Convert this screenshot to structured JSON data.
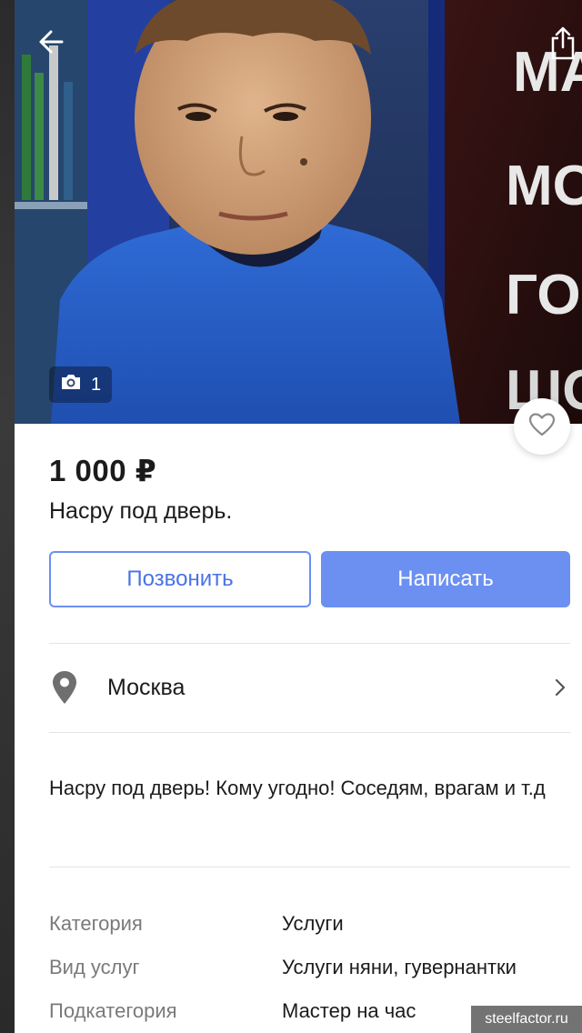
{
  "listing": {
    "price": "1 000 ₽",
    "title": "Насру под дверь.",
    "photo_count": "1"
  },
  "actions": {
    "call_label": "Позвонить",
    "write_label": "Написать"
  },
  "location": {
    "city": "Москва"
  },
  "description": {
    "text": "Насру под дверь! Кому угодно! Соседям, врагам и т.д"
  },
  "params": [
    {
      "key": "Категория",
      "value": "Услуги"
    },
    {
      "key": "Вид услуг",
      "value": "Услуги няни, гувернантки"
    },
    {
      "key": "Подкатегория",
      "value": "Мастер на час"
    }
  ],
  "photo_sign_text": "МА МО ГОР ШО",
  "watermark": "steelfactor.ru",
  "icons": {
    "back": "arrow-left-icon",
    "share": "share-icon",
    "camera": "camera-icon",
    "favorite": "heart-icon",
    "location": "map-pin-icon",
    "chevron": "chevron-right-icon"
  },
  "colors": {
    "accent": "#6b90f2",
    "accent_text": "#4a72e6",
    "text": "#1b1b1b",
    "muted": "#7a7a7a",
    "divider": "#e4e4e4"
  }
}
